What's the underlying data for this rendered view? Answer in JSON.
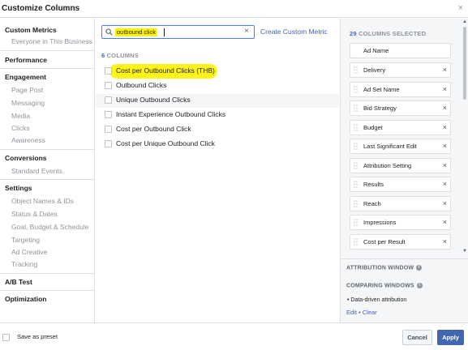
{
  "dialog": {
    "title": "Customize Columns",
    "close_glyph": "×"
  },
  "sidebar": {
    "sections": [
      {
        "label": "Custom Metrics",
        "items": [
          "Everyone in This Business"
        ]
      },
      {
        "label": "Performance",
        "items": []
      },
      {
        "label": "Engagement",
        "items": [
          "Page Post",
          "Messaging",
          "Media",
          "Clicks",
          "Awareness"
        ]
      },
      {
        "label": "Conversions",
        "items": [
          "Standard Events"
        ]
      },
      {
        "label": "Settings",
        "items": [
          "Object Names & IDs",
          "Status & Dates",
          "Goal, Budget & Schedule",
          "Targeting",
          "Ad Creative",
          "Tracking"
        ]
      },
      {
        "label": "A/B Test",
        "items": []
      },
      {
        "label": "Optimization",
        "items": []
      }
    ]
  },
  "search": {
    "value": "outbound click",
    "clear_glyph": "×",
    "create_link": "Create Custom Metric"
  },
  "results": {
    "count": "6",
    "count_suffix": "COLUMNS",
    "items": [
      {
        "label": "Cost per Outbound Clicks (THB)",
        "checked": false,
        "highlighted": true
      },
      {
        "label": "Outbound Clicks",
        "checked": false
      },
      {
        "label": "Unique Outbound Clicks",
        "checked": false
      },
      {
        "label": "Instant Experience Outbound Clicks",
        "checked": false
      },
      {
        "label": "Cost per Outbound Click",
        "checked": false
      },
      {
        "label": "Cost per Unique Outbound Click",
        "checked": false
      }
    ]
  },
  "selected": {
    "count": "29",
    "count_suffix": "COLUMNS SELECTED",
    "items": [
      {
        "label": "Ad Name",
        "removable": false
      },
      {
        "label": "Delivery",
        "removable": true
      },
      {
        "label": "Ad Set Name",
        "removable": true
      },
      {
        "label": "Bid Strategy",
        "removable": true
      },
      {
        "label": "Budget",
        "removable": true
      },
      {
        "label": "Last Significant Edit",
        "removable": true
      },
      {
        "label": "Attribution Setting",
        "removable": true
      },
      {
        "label": "Results",
        "removable": true
      },
      {
        "label": "Reach",
        "removable": true
      },
      {
        "label": "Impressions",
        "removable": true
      },
      {
        "label": "Cost per Result",
        "removable": true
      }
    ],
    "remove_glyph": "×"
  },
  "attribution": {
    "window_label": "ATTRIBUTION WINDOW",
    "comparing_label": "COMPARING WINDOWS",
    "info_glyph": "i",
    "bullet_text": "Data-driven attribution",
    "edit_label": "Edit",
    "separator": "•",
    "clear_label": "Clear"
  },
  "footer": {
    "preset_label": "Save as preset",
    "cancel_label": "Cancel",
    "apply_label": "Apply"
  },
  "colors": {
    "accent": "#4267b2",
    "highlight": "#fff200",
    "panel_bg": "#f5f6f7",
    "border": "#dddfe2"
  }
}
